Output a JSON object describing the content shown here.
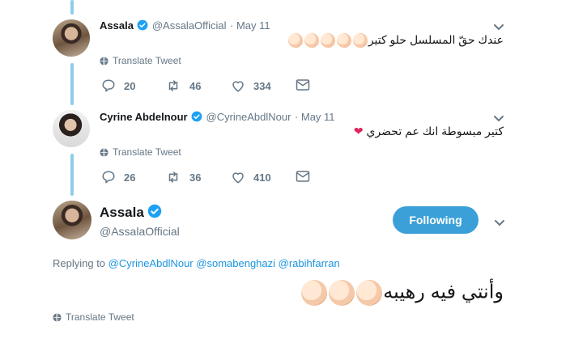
{
  "tweet1": {
    "name": "Assala",
    "handle": "@AssalaOfficial",
    "time": "· May 11",
    "text": "عندك حقّ المسلسل حلو كتير",
    "emoji": "👏👏👏👏👏",
    "translate": "Translate Tweet",
    "replies": "20",
    "retweets": "46",
    "likes": "334"
  },
  "tweet2": {
    "name": "Cyrine Abdelnour",
    "handle": "@CyrineAbdlNour",
    "time": "· May 11",
    "text": "كتير مبسوطة انك عم تحضري",
    "emoji": "❤",
    "translate": "Translate Tweet",
    "replies": "26",
    "retweets": "36",
    "likes": "410"
  },
  "main": {
    "name": "Assala",
    "handle": "@AssalaOfficial",
    "follow_label": "Following",
    "replying_prefix": "Replying to",
    "mention1": "@CyrineAbdlNour",
    "mention2": "@somabenghazi",
    "mention3": "@rabihfarran",
    "text": "وأنتي فيه رهيبه",
    "emoji": "👏👏👏",
    "translate": "Translate Tweet"
  },
  "colors": {
    "accent": "#3ba0d8",
    "link": "#1b95e0",
    "thread_line": "#8ecde9",
    "muted": "#657786"
  }
}
